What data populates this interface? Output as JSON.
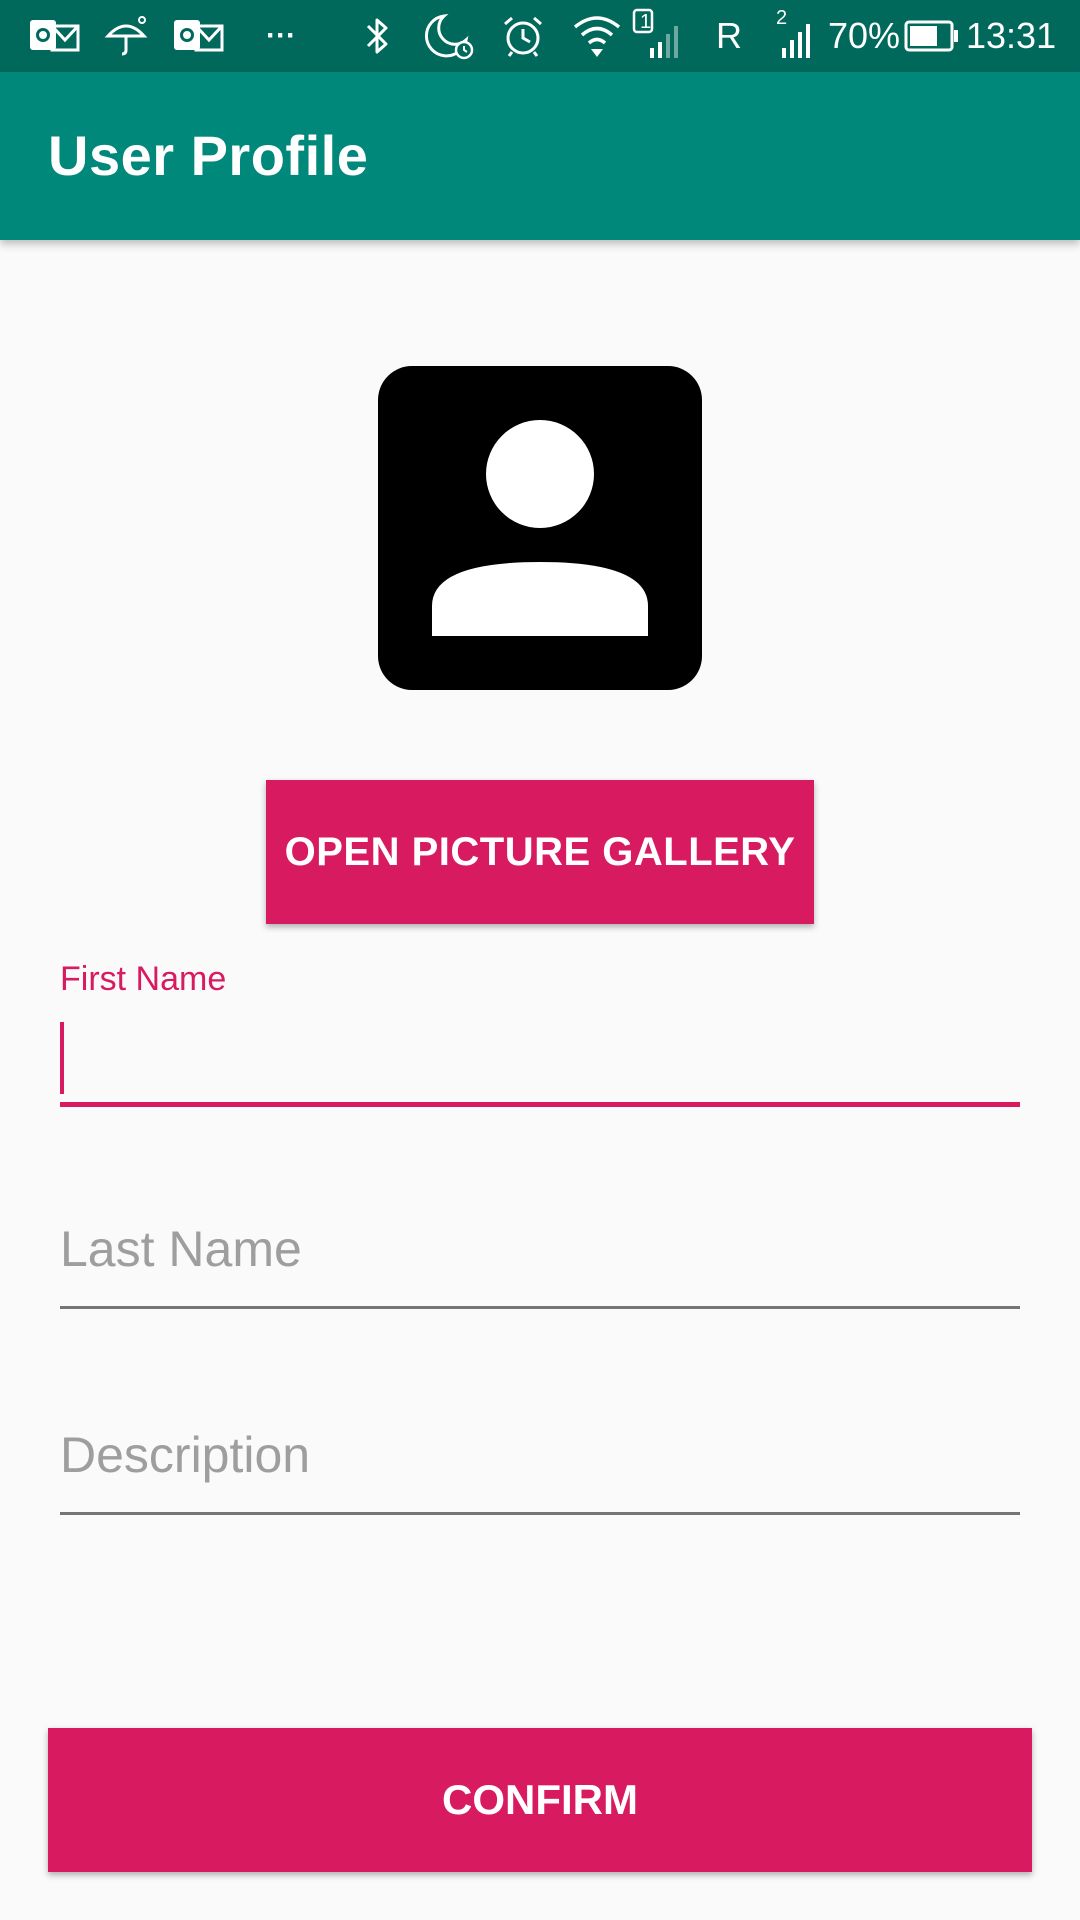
{
  "status_bar": {
    "time": "13:31",
    "battery_percent": "70%",
    "roaming": "R",
    "sim1": "1",
    "sim2": "2",
    "overflow": "···",
    "icons": [
      "outlook-icon",
      "umbrella-icon",
      "outlook-icon",
      "bluetooth-icon",
      "do-not-disturb-icon",
      "alarm-icon",
      "wifi-icon",
      "signal-icon",
      "signal-icon",
      "battery-icon"
    ],
    "battery_level": 0.7
  },
  "app_bar": {
    "title": "User Profile"
  },
  "profile": {
    "avatar_icon": "account-box-icon",
    "gallery_button_label": "OPEN PICTURE GALLERY"
  },
  "form": {
    "first_name": {
      "label": "First Name",
      "value": ""
    },
    "last_name": {
      "placeholder": "Last Name",
      "value": ""
    },
    "description": {
      "placeholder": "Description",
      "value": ""
    }
  },
  "confirm_label": "CONFIRM",
  "colors": {
    "status_bar": "#00695c",
    "app_bar": "#00897b",
    "accent": "#d81b60",
    "background": "#fafafa",
    "hint": "#9e9e9e"
  }
}
